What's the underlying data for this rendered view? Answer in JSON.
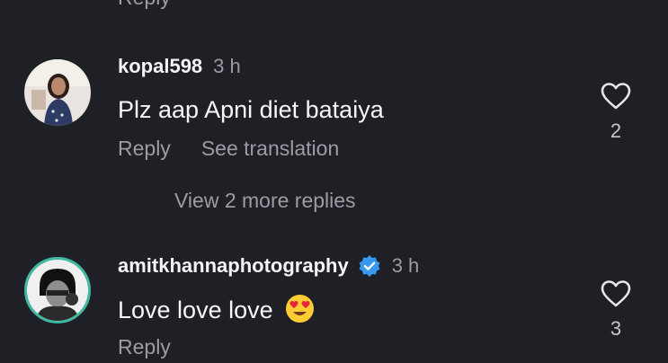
{
  "partial_top": {
    "text": "Reply"
  },
  "comments": [
    {
      "username": "kopal598",
      "time": "3 h",
      "text": "Plz aap Apni diet bataiya",
      "reply_label": "Reply",
      "translation_label": "See translation",
      "like_count": "2"
    },
    {
      "username": "amitkhannaphotography",
      "verified": true,
      "time": "3 h",
      "text": "Love love love",
      "emoji": "heart-eyes-emoji",
      "reply_label": "Reply",
      "like_count": "3"
    }
  ],
  "view_more_replies": "View 2 more replies",
  "colors": {
    "background": "#1f2026",
    "secondary_text": "#9c9ca4",
    "verified_blue": "#3897f0"
  }
}
